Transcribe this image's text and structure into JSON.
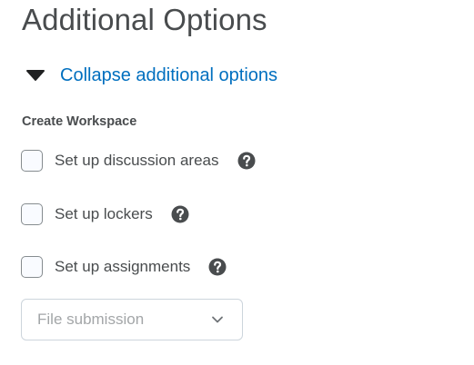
{
  "page": {
    "title": "Additional Options"
  },
  "collapse": {
    "label": "Collapse additional options",
    "icon": "caret-down-icon"
  },
  "workspace": {
    "section_label": "Create Workspace",
    "options": [
      {
        "label": "Set up discussion areas",
        "checked": false,
        "help_icon": "help-icon"
      },
      {
        "label": "Set up lockers",
        "checked": false,
        "help_icon": "help-icon"
      },
      {
        "label": "Set up assignments",
        "checked": false,
        "help_icon": "help-icon"
      }
    ],
    "assignment_type": {
      "selected": "File submission",
      "icon": "chevron-down-icon"
    }
  },
  "colors": {
    "link": "#006fbf",
    "text": "#494c4e",
    "placeholder": "#a3a6a8",
    "help_icon": "#494c4e",
    "checkbox_border": "#868c8f"
  }
}
